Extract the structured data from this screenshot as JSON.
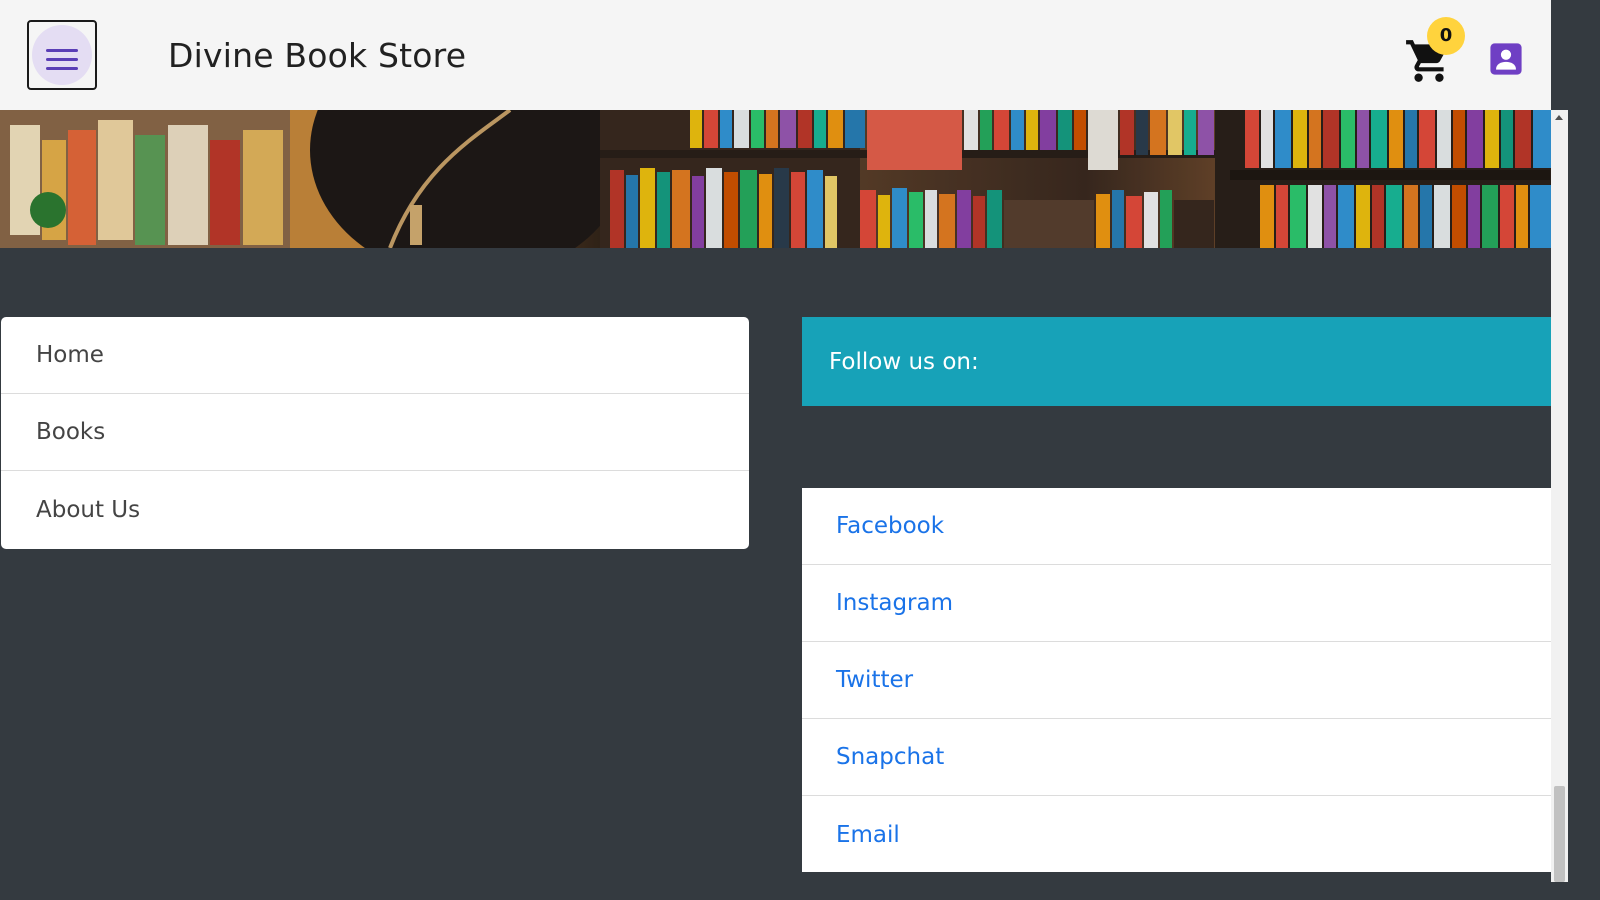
{
  "header": {
    "brand": "Divine Book Store",
    "cart_count": "0",
    "accent_color": "#5a3eb6",
    "badge_color": "#ffd33d",
    "icons": [
      "menu-icon",
      "cart-icon",
      "account-icon"
    ]
  },
  "nav": {
    "items": [
      {
        "label": "Home"
      },
      {
        "label": "Books"
      },
      {
        "label": "About Us"
      }
    ]
  },
  "follow": {
    "title": "Follow us on:",
    "color": "#17a2b8"
  },
  "social": {
    "items": [
      {
        "label": "Facebook"
      },
      {
        "label": "Instagram"
      },
      {
        "label": "Twitter"
      },
      {
        "label": "Snapchat"
      },
      {
        "label": "Email"
      }
    ],
    "link_color": "#1a73e8"
  },
  "footer": {
    "background": "#343a40"
  }
}
